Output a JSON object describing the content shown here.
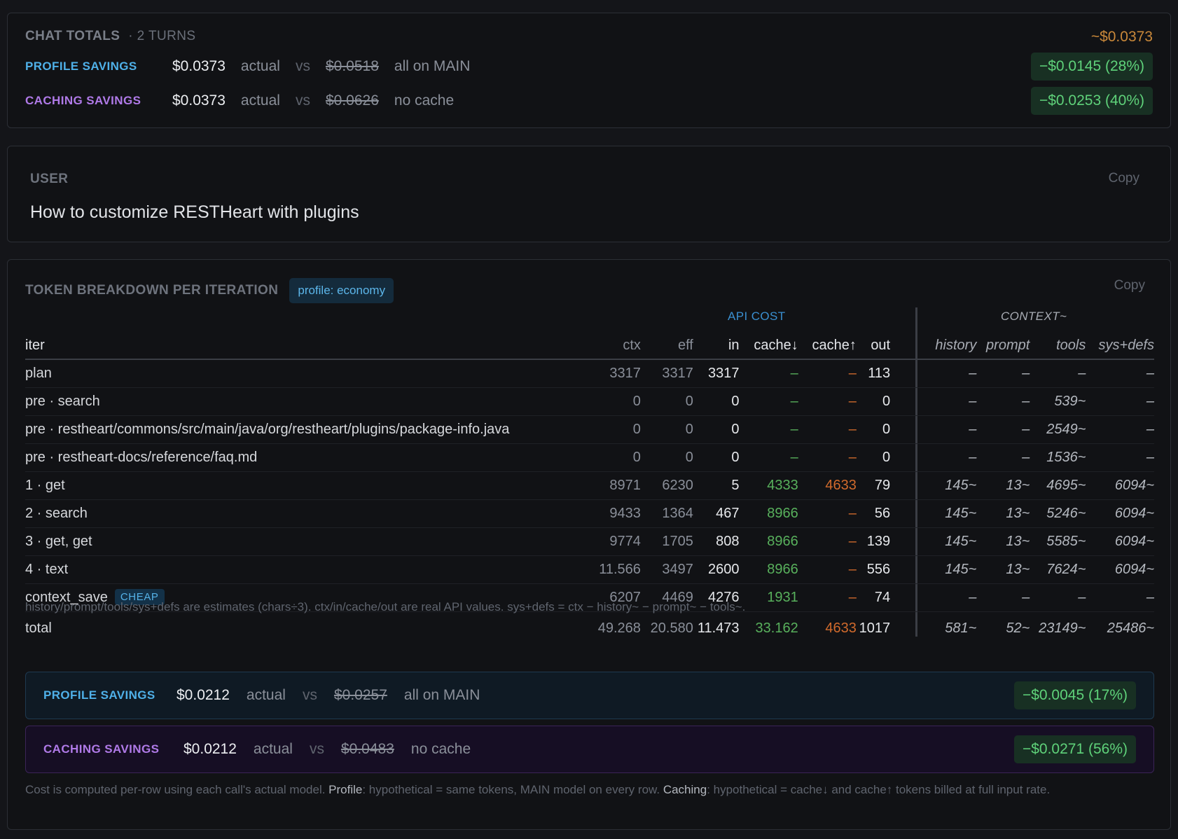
{
  "totals": {
    "title": "CHAT TOTALS",
    "turns": "· 2 TURNS",
    "amount": "~$0.0373",
    "profile": {
      "label": "PROFILE SAVINGS",
      "actual": "$0.0373",
      "actual_word": "actual",
      "vs": "vs",
      "hypothetical": "$0.0518",
      "note": "all on MAIN",
      "saving": "−$0.0145 (28%)"
    },
    "caching": {
      "label": "CACHING SAVINGS",
      "actual": "$0.0373",
      "actual_word": "actual",
      "vs": "vs",
      "hypothetical": "$0.0626",
      "note": "no cache",
      "saving": "−$0.0253 (40%)"
    }
  },
  "user": {
    "label": "USER",
    "copy": "Copy",
    "message": "How to customize RESTHeart with plugins"
  },
  "tokens": {
    "title": "TOKEN BREAKDOWN PER ITERATION",
    "profile_pill": "profile: economy",
    "copy": "Copy",
    "group_api": "API COST",
    "group_ctx": "CONTEXT~",
    "headers": [
      "iter",
      "ctx",
      "eff",
      "in",
      "cache↓",
      "cache↑",
      "out",
      "history",
      "prompt",
      "tools",
      "sys+defs"
    ],
    "rows": [
      {
        "iter": "plan",
        "ctx": "3317",
        "eff": "3317",
        "in": "3317",
        "cache_down": "–",
        "cache_up": "–",
        "out": "113",
        "history": "–",
        "prompt": "–",
        "tools": "–",
        "sysdefs": "–"
      },
      {
        "iter": "pre · search",
        "ctx": "0",
        "eff": "0",
        "in": "0",
        "cache_down": "–",
        "cache_up": "–",
        "out": "0",
        "history": "–",
        "prompt": "–",
        "tools": "539~",
        "sysdefs": "–"
      },
      {
        "iter": "pre · restheart/commons/src/main/java/org/restheart/plugins/package-info.java",
        "ctx": "0",
        "eff": "0",
        "in": "0",
        "cache_down": "–",
        "cache_up": "–",
        "out": "0",
        "history": "–",
        "prompt": "–",
        "tools": "2549~",
        "sysdefs": "–"
      },
      {
        "iter": "pre · restheart-docs/reference/faq.md",
        "ctx": "0",
        "eff": "0",
        "in": "0",
        "cache_down": "–",
        "cache_up": "–",
        "out": "0",
        "history": "–",
        "prompt": "–",
        "tools": "1536~",
        "sysdefs": "–"
      },
      {
        "iter": "1 · get",
        "ctx": "8971",
        "eff": "6230",
        "in": "5",
        "cache_down": "4333",
        "cache_up": "4633",
        "out": "79",
        "history": "145~",
        "prompt": "13~",
        "tools": "4695~",
        "sysdefs": "6094~"
      },
      {
        "iter": "2 · search",
        "ctx": "9433",
        "eff": "1364",
        "in": "467",
        "cache_down": "8966",
        "cache_up": "–",
        "out": "56",
        "history": "145~",
        "prompt": "13~",
        "tools": "5246~",
        "sysdefs": "6094~"
      },
      {
        "iter": "3 · get, get",
        "ctx": "9774",
        "eff": "1705",
        "in": "808",
        "cache_down": "8966",
        "cache_up": "–",
        "out": "139",
        "history": "145~",
        "prompt": "13~",
        "tools": "5585~",
        "sysdefs": "6094~"
      },
      {
        "iter": "4 · text",
        "ctx": "11.566",
        "eff": "3497",
        "in": "2600",
        "cache_down": "8966",
        "cache_up": "–",
        "out": "556",
        "history": "145~",
        "prompt": "13~",
        "tools": "7624~",
        "sysdefs": "6094~"
      },
      {
        "iter": "context_save",
        "badge": "CHEAP",
        "ctx": "6207",
        "eff": "4469",
        "in": "4276",
        "cache_down": "1931",
        "cache_up": "–",
        "out": "74",
        "history": "–",
        "prompt": "–",
        "tools": "–",
        "sysdefs": "–"
      }
    ],
    "total": {
      "iter": "total",
      "ctx": "49.268",
      "eff": "20.580",
      "in": "11.473",
      "cache_down": "33.162",
      "cache_up": "4633",
      "out": "1017",
      "history": "581~",
      "prompt": "52~",
      "tools": "23149~",
      "sysdefs": "25486~"
    },
    "estimates_note": "history/prompt/tools/sys+defs are estimates (chars÷3). ctx/in/cache/out are real API values. sys+defs = ctx − history~ − prompt~ − tools~.",
    "profile": {
      "label": "PROFILE SAVINGS",
      "actual": "$0.0212",
      "actual_word": "actual",
      "vs": "vs",
      "hypothetical": "$0.0257",
      "note": "all on MAIN",
      "saving": "−$0.0045 (17%)"
    },
    "caching": {
      "label": "CACHING SAVINGS",
      "actual": "$0.0212",
      "actual_word": "actual",
      "vs": "vs",
      "hypothetical": "$0.0483",
      "note": "no cache",
      "saving": "−$0.0271 (56%)"
    },
    "cost_note": {
      "part1": "Cost is computed per-row using each call's actual model. ",
      "profile_word": "Profile",
      "part2": ": hypothetical = same tokens, MAIN model on every row. ",
      "caching_word": "Caching",
      "part3": ": hypothetical = cache↓ and cache↑ tokens billed at full input rate."
    }
  },
  "colors": {
    "background": "#141519",
    "green": "#5fd27a",
    "orange": "#d06a2c",
    "blue": "#4fb0e8",
    "purple": "#b07ae8",
    "amber": "#c9883a"
  }
}
